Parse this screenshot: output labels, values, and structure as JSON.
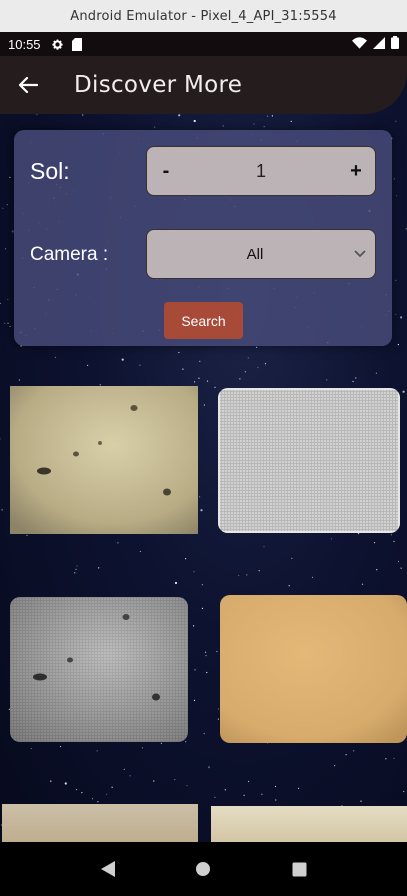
{
  "window": {
    "title": "Android Emulator - Pixel_4_API_31:5554"
  },
  "status_bar": {
    "time": "10:55",
    "left_icons": [
      "gear-icon",
      "sim-icon"
    ],
    "right_icons": [
      "wifi-icon",
      "signal-icon",
      "battery-icon"
    ]
  },
  "app_bar": {
    "title": "Discover More",
    "back_icon": "arrow-back-icon"
  },
  "search_form": {
    "sol_label": "Sol:",
    "sol_value": "1",
    "decrement_label": "-",
    "increment_label": "+",
    "camera_label": "Camera :",
    "camera_selected": "All",
    "search_label": "Search"
  },
  "photos": [
    {
      "tone": "beige"
    },
    {
      "tone": "grey-grid"
    },
    {
      "tone": "grey"
    },
    {
      "tone": "tan"
    },
    {
      "tone": "beige"
    },
    {
      "tone": "beige-light"
    }
  ],
  "colors": {
    "app_bar": "#241c1d",
    "panel": "#464a78",
    "field": "#bcb3b6",
    "search_button": "#a84a38"
  }
}
